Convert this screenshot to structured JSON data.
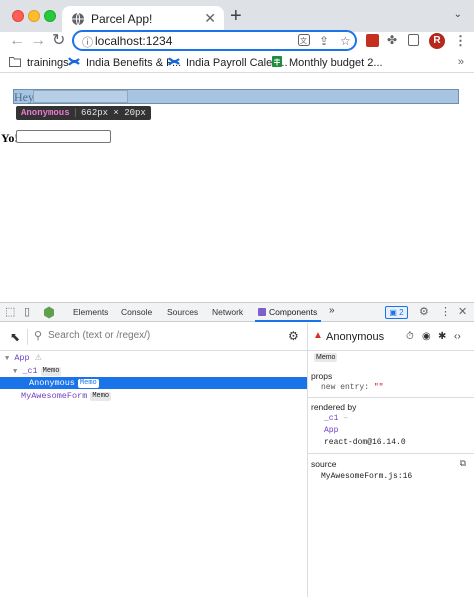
{
  "browser": {
    "tab_title": "Parcel App!",
    "tab_close": "✕",
    "new_tab": "+",
    "url": "localhost:1234"
  },
  "bookmarks": [
    {
      "label": "trainings",
      "icon": "folder-icon"
    },
    {
      "label": "India Benefits & P...",
      "icon": "confluence-icon"
    },
    {
      "label": "India Payroll Calen...",
      "icon": "confluence-icon"
    },
    {
      "label": "Monthly budget 2...",
      "icon": "sheets-icon"
    }
  ],
  "bookmarks_more": "»",
  "avatar_letter": "R",
  "page": {
    "hey_label": "Hey",
    "tooltip_name": "Anonymous",
    "tooltip_size": "662px × 20px",
    "yo_label": "Yo!"
  },
  "devtools": {
    "tabs": [
      "Elements",
      "Console",
      "Sources",
      "Network",
      "Components"
    ],
    "active_tab": "Components",
    "more": "»",
    "issues_count": "2",
    "search_placeholder": "Search (text or /regex/)",
    "tree": [
      {
        "name": "App",
        "depth": 0,
        "expanded": true,
        "memo": false,
        "warning": true
      },
      {
        "name": "_c1",
        "depth": 1,
        "expanded": true,
        "memo": true
      },
      {
        "name": "Anonymous",
        "depth": 2,
        "memo": true,
        "selected": true
      },
      {
        "name": "MyAwesomeForm",
        "depth": 0,
        "memo": true
      }
    ],
    "memo_badge": "Memo",
    "side": {
      "title": "Anonymous",
      "memo_badge": "Memo",
      "props_label": "props",
      "prop_key": "new entry:",
      "prop_value": "\"\"",
      "rendered_by_label": "rendered by",
      "rendered_by": [
        "_c1",
        "App",
        "react-dom@16.14.0"
      ],
      "source_label": "source",
      "source_value": "MyAwesomeForm.js:16"
    }
  },
  "colors": {
    "accent": "#1a73e8",
    "highlight": "#a7c4e0",
    "component": "#6f42c1",
    "tooltip_bg": "#333333"
  }
}
